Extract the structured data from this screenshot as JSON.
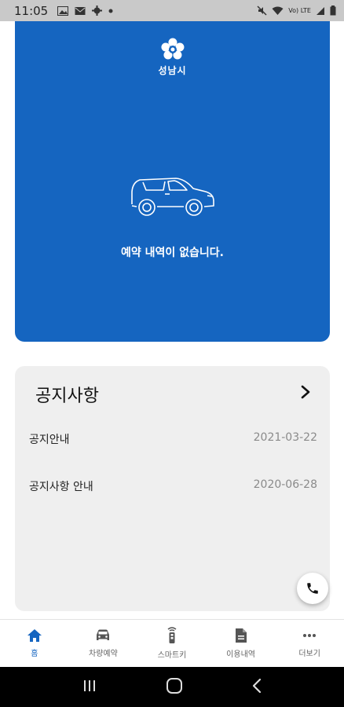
{
  "status_bar": {
    "time": "11:05",
    "icons_left": [
      "image-icon",
      "mail-icon",
      "settings-icon",
      "dot-icon"
    ],
    "icons_right": [
      "mute-icon",
      "wifi-icon",
      "lte-signal-icon",
      "signal-icon",
      "battery-icon"
    ],
    "network_label": "Vo) LTE"
  },
  "hero": {
    "logo_text": "성남시",
    "empty_message": "예약 내역이 없습니다.",
    "background_color": "#1565c0"
  },
  "notice": {
    "title": "공지사항",
    "items": [
      {
        "title": "공지안내",
        "date": "2021-03-22"
      },
      {
        "title": "공지사항 안내",
        "date": "2020-06-28"
      }
    ]
  },
  "bottom_nav": {
    "items": [
      {
        "label": "홈",
        "icon": "home-icon",
        "active": true
      },
      {
        "label": "차량예약",
        "icon": "car-icon",
        "active": false
      },
      {
        "label": "스마트키",
        "icon": "smart-key-icon",
        "active": false
      },
      {
        "label": "이용내역",
        "icon": "document-icon",
        "active": false
      },
      {
        "label": "더보기",
        "icon": "more-icon",
        "active": false
      }
    ]
  },
  "system_nav": [
    "recents-icon",
    "home-icon",
    "back-icon"
  ]
}
